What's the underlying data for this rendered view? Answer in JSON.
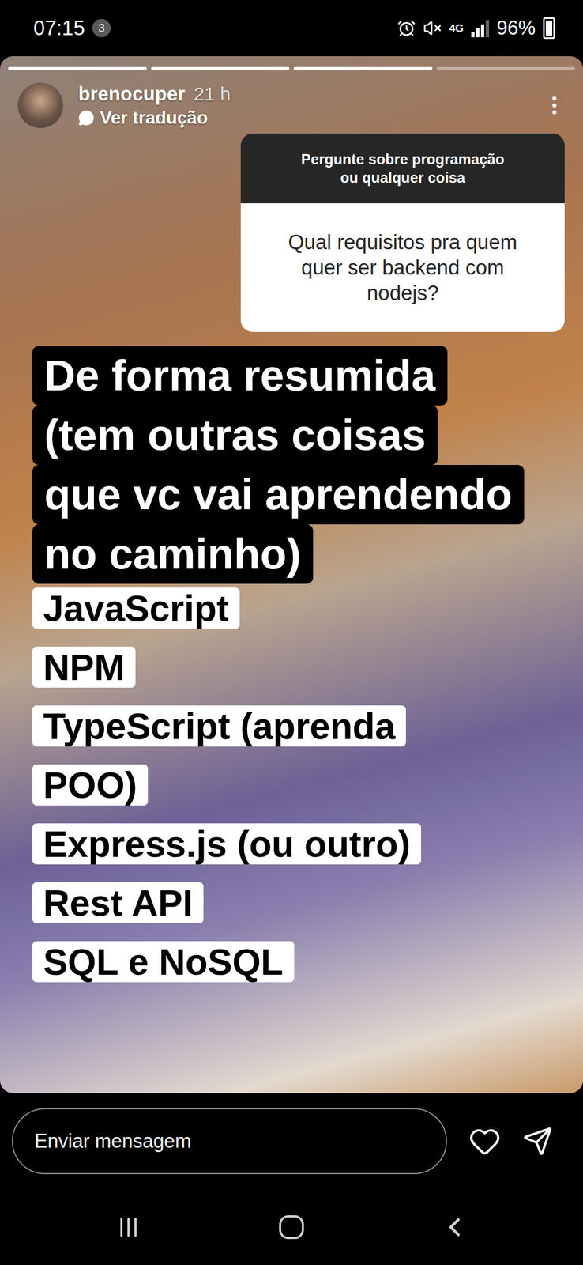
{
  "status_bar": {
    "time": "07:15",
    "notification_count": "3",
    "network": "4G",
    "signal_level": 0.75,
    "battery": "96%",
    "battery_level": 0.96
  },
  "story": {
    "progress": [
      {
        "level": 1
      },
      {
        "level": 1
      },
      {
        "level": 1
      },
      {
        "level": 0
      }
    ],
    "username": "brenocuper",
    "age": "21 h",
    "translate": "Ver tradução",
    "question_sticker": {
      "prompt": "Pergunte sobre programação ou qualquer coisa",
      "question": "Qual requisitos pra quem quer ser backend com nodejs?"
    },
    "heading_lines": [
      "De forma resumida",
      "(tem outras coisas",
      "que vc vai aprendendo",
      "no caminho)"
    ],
    "list": [
      "JavaScript",
      "NPM",
      "TypeScript (aprenda POO)",
      "Express.js (ou outro)",
      "Rest API",
      "SQL e NoSQL"
    ]
  },
  "reply_bar": {
    "placeholder": "Enviar mensagem"
  }
}
